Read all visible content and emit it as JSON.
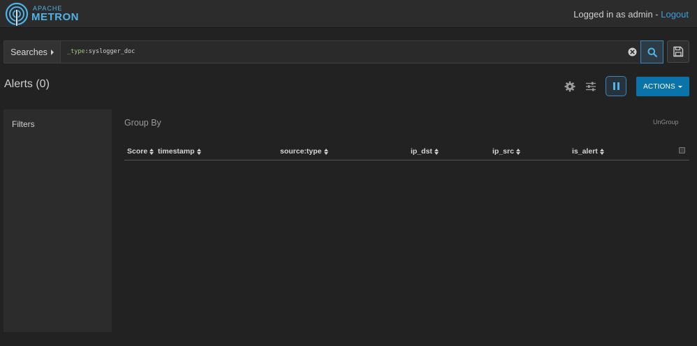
{
  "header": {
    "logo": {
      "line1": "APACHE",
      "line2": "METRON",
      "icon": "metron-radar-icon"
    },
    "login_text": "Logged in as admin - ",
    "logout_label": "Logout"
  },
  "search": {
    "searches_label": "Searches",
    "query_key": "_type",
    "query_separator": ":",
    "query_value": "syslogger_doc",
    "icons": {
      "clear": "clear-circle-icon",
      "search": "search-icon",
      "save": "floppy-disk-icon"
    }
  },
  "alerts": {
    "title": "Alerts (0)",
    "toolbar_icons": [
      "gear-icon",
      "sliders-icon",
      "pause-icon"
    ],
    "actions_label": "ACTIONS"
  },
  "filters": {
    "label": "Filters"
  },
  "groupby": {
    "label": "Group By",
    "ungroup_label": "UnGroup"
  },
  "table": {
    "columns": [
      "Score",
      "timestamp",
      "source:type",
      "ip_dst",
      "ip_src",
      "is_alert"
    ]
  },
  "colors": {
    "background": "#222222",
    "panel": "#2c2c2c",
    "accent": "#4fb3e8",
    "actions_button": "#0a73aa",
    "link": "#3a9fd8"
  }
}
